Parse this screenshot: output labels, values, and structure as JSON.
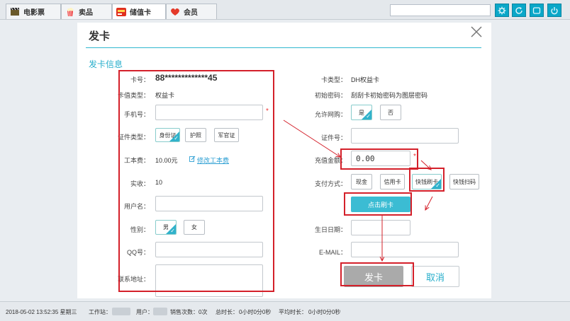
{
  "tabs": [
    {
      "label": "电影票",
      "icon": "film-icon"
    },
    {
      "label": "卖品",
      "icon": "popcorn-icon"
    },
    {
      "label": "储值卡",
      "icon": "card-icon"
    },
    {
      "label": "会员",
      "icon": "heart-icon"
    }
  ],
  "toolbar_icons": [
    "settings-icon",
    "refresh-icon",
    "window-icon",
    "power-icon"
  ],
  "dialog": {
    "title": "发卡",
    "section_title": "发卡信息",
    "left": {
      "card_no_label": "卡号：",
      "card_no": "88*************45",
      "card_type_label": "卡值类型：",
      "card_type": "权益卡",
      "phone_label": "手机号：",
      "phone_value": "",
      "id_type_label": "证件类型：",
      "id_types": [
        "身份证",
        "护照",
        "军官证"
      ],
      "id_type_selected": "身份证",
      "fee_label": "工本费：",
      "fee_value": "10.00元",
      "edit_fee_link": "修改工本费",
      "actual_label": "实收：",
      "actual_value": "10",
      "username_label": "用户名：",
      "username_value": "",
      "gender_label": "性别：",
      "genders": [
        "男",
        "女"
      ],
      "gender_selected": "男",
      "qq_label": "QQ号：",
      "qq_value": "",
      "address_label": "联系地址：",
      "address_value": ""
    },
    "right": {
      "card_kind_label": "卡类型：",
      "card_kind": "DH权益卡",
      "init_pwd_label": "初始密码：",
      "init_pwd": "刮刮卡初始密码为图层密码",
      "allow_online_label": "允许网购：",
      "allow_online_options": [
        "是",
        "否"
      ],
      "allow_online_selected": "是",
      "id_no_label": "证件号：",
      "id_no_value": "",
      "recharge_label": "充值金额：",
      "recharge_value": "0.00",
      "pay_label": "支付方式：",
      "pay_options": [
        "现金",
        "信用卡",
        "快钱刷卡",
        "快钱扫码"
      ],
      "pay_selected": "快钱刷卡",
      "swipe_button": "点击刷卡",
      "birthday_label": "生日日期：",
      "birthday_value": "",
      "email_label": "E-MAIL：",
      "email_value": ""
    },
    "submit_button": "发卡",
    "cancel_button": "取消"
  },
  "status": {
    "datetime": "2018-05-02 13:52:35 星期三",
    "station_label": "工作站：",
    "user_label": "用户：",
    "sales_label": "销售次数：",
    "sales_value": "0次",
    "total_label": "总时长：",
    "total_value": "0小时0分0秒",
    "avg_label": "平均时长：",
    "avg_value": "0小时0分0秒"
  },
  "colors": {
    "accent": "#31b8cf",
    "annotation": "#d4202a",
    "submit_disabled": "#aaaaaa"
  }
}
